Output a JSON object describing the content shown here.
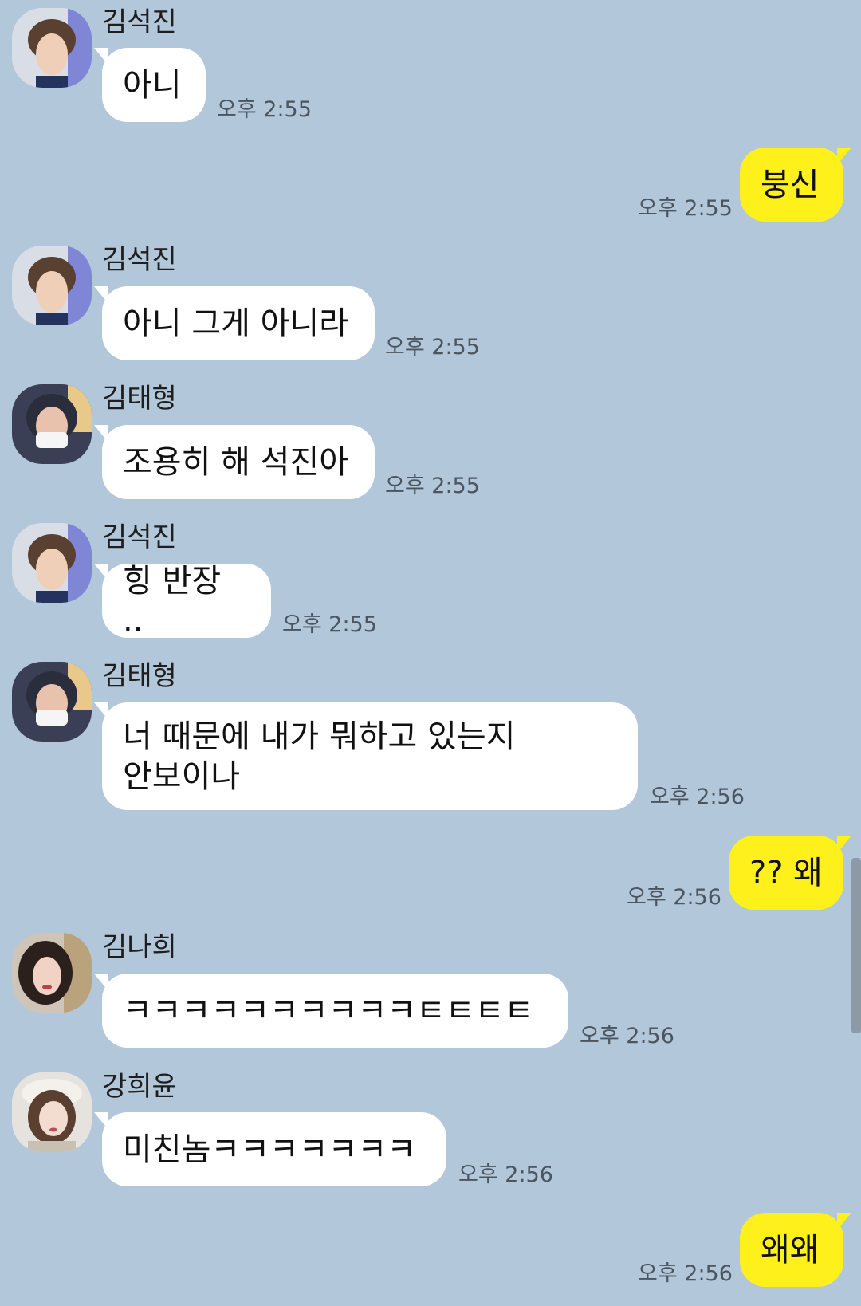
{
  "messages": [
    {
      "sender": "김석진",
      "avatar": "jin",
      "text": "아니",
      "time": "오후 2:55"
    },
    {
      "mine": true,
      "text": "붕신",
      "time": "오후 2:55"
    },
    {
      "sender": "김석진",
      "avatar": "jin",
      "text": "아니 그게 아니라",
      "time": "오후 2:55"
    },
    {
      "sender": "김태형",
      "avatar": "taehyung",
      "text": "조용히 해 석진아",
      "time": "오후 2:55"
    },
    {
      "sender": "김석진",
      "avatar": "jin",
      "text": "힝 반장 ..",
      "time": "오후 2:55"
    },
    {
      "sender": "김태형",
      "avatar": "taehyung",
      "text": "너 때문에 내가 뭐하고 있는지\n안보이나",
      "time": "오후 2:56"
    },
    {
      "mine": true,
      "text": "?? 왜",
      "time": "오후 2:56"
    },
    {
      "sender": "김나희",
      "avatar": "nahee",
      "text": "ㅋㅋㅋㅋㅋㅋㅋㅋㅋㅋㅌㅌㅌㅌ",
      "time": "오후 2:56"
    },
    {
      "sender": "강희윤",
      "avatar": "heeyun",
      "text": "미친놈ㅋㅋㅋㅋㅋㅋㅋ",
      "time": "오후 2:56"
    },
    {
      "mine": true,
      "text": "왜왜",
      "time": "오후 2:56"
    }
  ],
  "colors": {
    "background": "#b2c7da",
    "my_bubble": "#fef01b",
    "other_bubble": "#ffffff"
  }
}
